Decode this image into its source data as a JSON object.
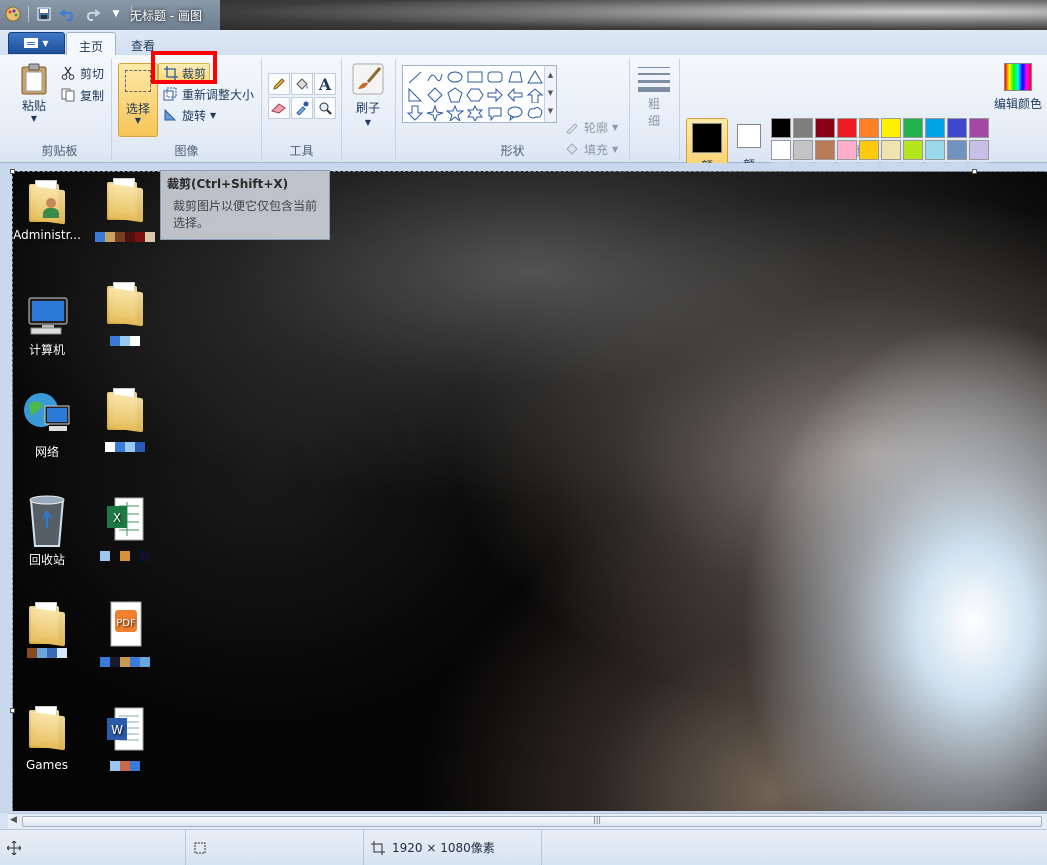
{
  "window": {
    "title": "无标题 - 画图"
  },
  "tabs": [
    {
      "label": "主页",
      "active": true
    },
    {
      "label": "查看",
      "active": false
    }
  ],
  "ribbon": {
    "clipboard": {
      "label": "剪贴板",
      "paste": "粘贴",
      "cut": "剪切",
      "copy": "复制"
    },
    "image": {
      "label": "图像",
      "select": "选择",
      "crop": "裁剪",
      "resize": "重新调整大小",
      "rotate": "旋转"
    },
    "tools": {
      "label": "工具"
    },
    "brushes": {
      "label": "刷子"
    },
    "shapes": {
      "label": "形状",
      "outline": "轮廓",
      "fill": "填充"
    },
    "size": {
      "label1": "粗",
      "label2": "细"
    },
    "colors": {
      "label": "颜色",
      "color1_label1": "颜",
      "color1_label2": "色 1",
      "color2_label1": "颜",
      "color2_label2": "色 2",
      "edit_label": "编辑颜色",
      "color1": "#000000",
      "color2": "#ffffff",
      "palette_row1": [
        "#000000",
        "#7f7f7f",
        "#880015",
        "#ed1c24",
        "#ff7f27",
        "#fff200",
        "#22b14c",
        "#00a2e8",
        "#3f48cc",
        "#a349a4"
      ],
      "palette_row2": [
        "#ffffff",
        "#c3c3c3",
        "#b97a57",
        "#ffaec9",
        "#ffc90e",
        "#efe4b0",
        "#b5e61d",
        "#99d9ea",
        "#7092be",
        "#c8bfe7"
      ]
    }
  },
  "tooltip": {
    "title": "裁剪(Ctrl+Shift+X)",
    "body_line1": "裁剪图片以便它仅包含当前",
    "body_line2": "选择。"
  },
  "desktop_icons": [
    {
      "label": "Administr..."
    },
    {
      "label": "计算机"
    },
    {
      "label": "网络"
    },
    {
      "label": "回收站"
    },
    {
      "label": "Games"
    }
  ],
  "status": {
    "dimensions": "1920 × 1080像素"
  }
}
